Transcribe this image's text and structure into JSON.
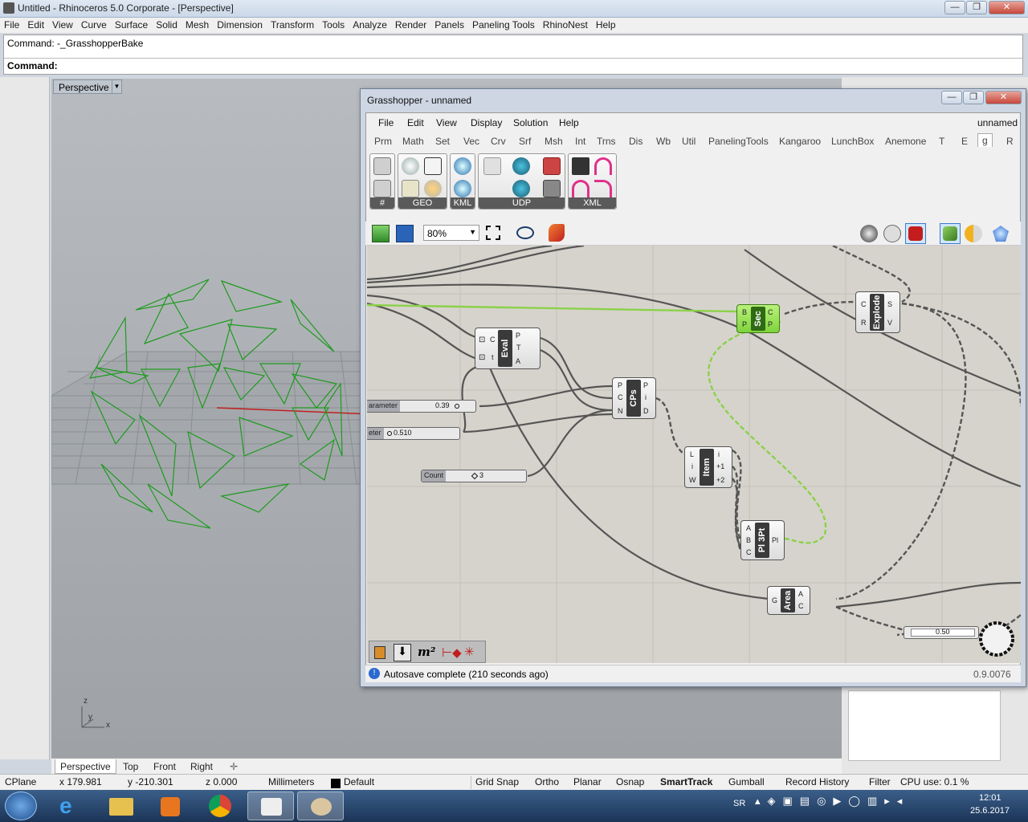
{
  "window": {
    "title": "Untitled - Rhinoceros  5.0 Corporate - [Perspective]"
  },
  "menu": [
    "File",
    "Edit",
    "View",
    "Curve",
    "Surface",
    "Solid",
    "Mesh",
    "Dimension",
    "Transform",
    "Tools",
    "Analyze",
    "Render",
    "Panels",
    "Paneling Tools",
    "RhinoNest",
    "Help"
  ],
  "command": {
    "history": "Command: -_GrasshopperBake",
    "prompt": "Command:"
  },
  "viewport": {
    "title": "Perspective",
    "tabs": [
      "Perspective",
      "Top",
      "Front",
      "Right"
    ],
    "axes": {
      "z": "z",
      "y": "y",
      "x": "x"
    }
  },
  "status": {
    "cplane": "CPlane",
    "x": "x 179.981",
    "y": "y -210.301",
    "z": "z 0.000",
    "units": "Millimeters",
    "layer": "Default",
    "toggles": [
      "Grid Snap",
      "Ortho",
      "Planar",
      "Osnap",
      "SmartTrack",
      "Gumball",
      "Record History",
      "Filter"
    ],
    "cpu": "CPU use: 0.1 %"
  },
  "grasshopper": {
    "title": "Grasshopper - unnamed",
    "menu": [
      "File",
      "Edit",
      "View",
      "Display",
      "Solution",
      "Help"
    ],
    "doc_name": "unnamed",
    "tabs": [
      "Prm",
      "Math",
      "Set",
      "Vec",
      "Crv",
      "Srf",
      "Msh",
      "Int",
      "Trns",
      "Dis",
      "Wb",
      "Util",
      "PanelingTools",
      "Kangaroo",
      "LunchBox",
      "Anemone",
      "T",
      "E",
      "g",
      "R"
    ],
    "active_tab": "g",
    "ribbon_groups": [
      "#",
      "GEO",
      "KML",
      "UDP",
      "XML"
    ],
    "zoom": "80%",
    "components": {
      "eval": {
        "name": "Eval",
        "inputs": [
          "C",
          "t"
        ],
        "outputs": [
          "P",
          "T",
          "A"
        ]
      },
      "cps": {
        "name": "CPs",
        "inputs": [
          "P",
          "C",
          "N"
        ],
        "outputs": [
          "P",
          "i",
          "D"
        ]
      },
      "item": {
        "name": "Item",
        "inputs": [
          "L",
          "i",
          "W"
        ],
        "outputs": [
          "i",
          "+1",
          "+2"
        ]
      },
      "pl3pt": {
        "name": "Pl 3Pt",
        "inputs": [
          "A",
          "B",
          "C"
        ],
        "outputs": [
          "Pl"
        ]
      },
      "area": {
        "name": "Area",
        "inputs": [
          "G"
        ],
        "outputs": [
          "A",
          "C"
        ]
      },
      "sec": {
        "name": "Sec",
        "inputs": [
          "B",
          "P"
        ],
        "outputs": [
          "C",
          "P"
        ]
      },
      "explode": {
        "name": "Explode",
        "inputs": [
          "C",
          "R"
        ],
        "outputs": [
          "S",
          "V"
        ]
      }
    },
    "sliders": {
      "s1": {
        "name": "arameter",
        "value": "0.39"
      },
      "s2": {
        "name": "eter",
        "value": "0.510"
      },
      "s3": {
        "name": "Count",
        "value": "3"
      },
      "s4": {
        "value": "0.50"
      }
    },
    "status_text": "Autosave complete (210 seconds ago)",
    "version": "0.9.0076"
  },
  "taskbar": {
    "lang": "SR",
    "time": "12:01",
    "date": "25.6.2017"
  },
  "colors": {
    "geometry_green": "#1f9a1f",
    "wire_green": "#8bd14a",
    "selected_comp": "#8fe04a"
  }
}
